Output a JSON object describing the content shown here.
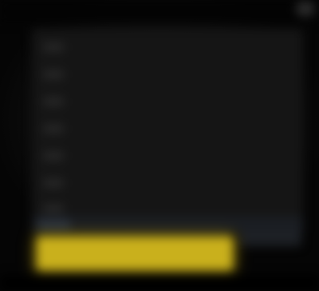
{
  "window": {
    "title": ""
  },
  "panel": {
    "items": [
      {
        "label": "",
        "icon": "menu-item-icon"
      },
      {
        "label": "",
        "icon": "menu-item-icon"
      },
      {
        "label": "",
        "icon": "menu-item-icon"
      },
      {
        "label": "",
        "icon": "menu-item-icon"
      },
      {
        "label": "",
        "icon": "menu-item-icon"
      },
      {
        "label": "",
        "icon": "menu-item-icon"
      },
      {
        "label": "",
        "icon": "menu-item-icon"
      }
    ]
  },
  "input": {
    "value": "",
    "placeholder": ""
  },
  "buttons": {
    "primary_label": "",
    "secondary_label": ""
  },
  "colors": {
    "background": "#000000",
    "panel": "#151515",
    "accent": "#c9b01c"
  }
}
